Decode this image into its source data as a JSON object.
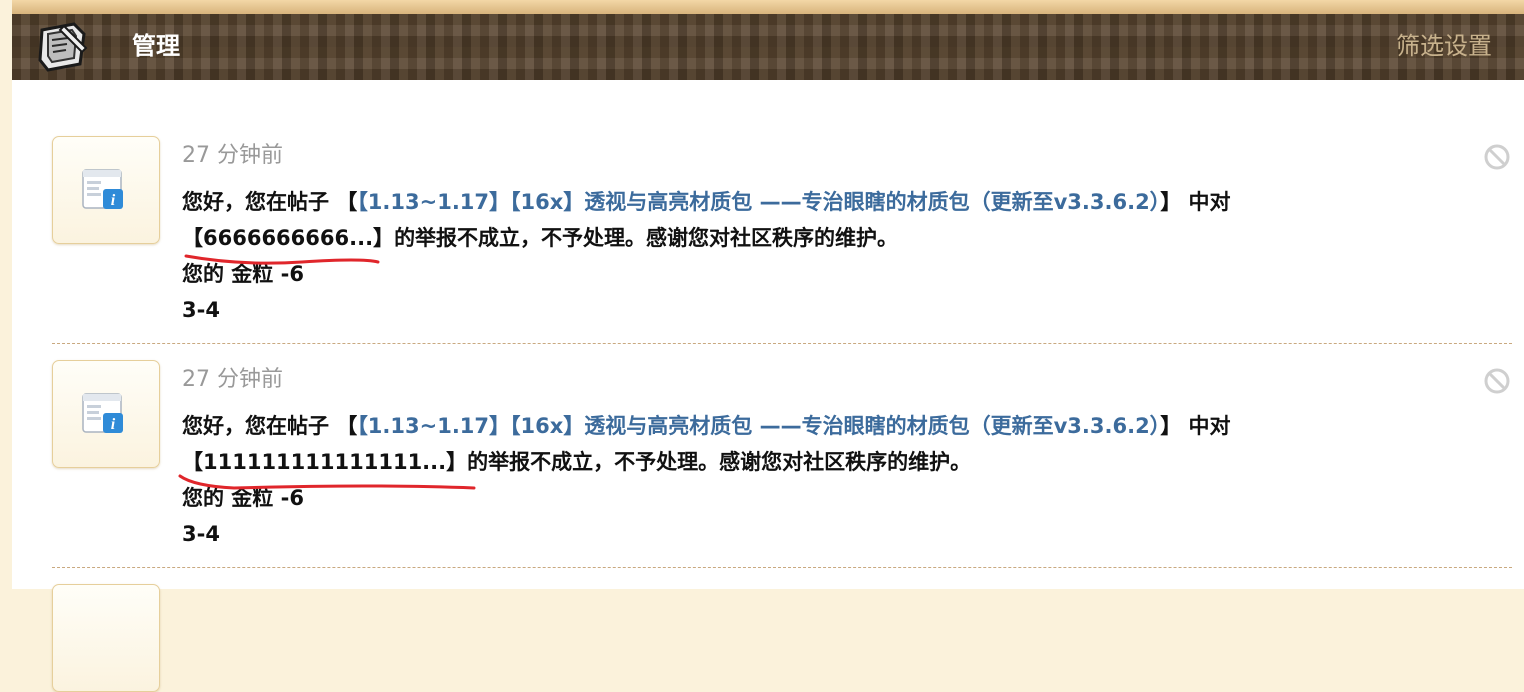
{
  "header": {
    "title": "管理",
    "filter_label": "筛选设置",
    "logo_icon": "book-quill-icon"
  },
  "notices": [
    {
      "time": "27 分钟前",
      "prefix": "您好，您在帖子 【",
      "post_link": "【1.13~1.17】【16x】透视与高亮材质包 ——专治眼瞎的材质包（更新至v3.3.6.2）",
      "after_link": "】 中对",
      "line2_quote": "【6666666666...】",
      "line2_rest": "的举报不成立，不予处理。感谢您对社区秩序的维护。",
      "credits": "您的 金粒 -6",
      "extra": "3-4",
      "ban_icon": "ban-icon"
    },
    {
      "time": "27 分钟前",
      "prefix": "您好，您在帖子 【",
      "post_link": "【1.13~1.17】【16x】透视与高亮材质包 ——专治眼瞎的材质包（更新至v3.3.6.2）",
      "after_link": "】 中对",
      "line2_quote": "【111111111111111...】",
      "line2_rest": "的举报不成立，不予处理。感谢您对社区秩序的维护。",
      "credits": "您的 金粒 -6",
      "extra": "3-4",
      "ban_icon": "ban-icon"
    }
  ],
  "colors": {
    "header_bg": "#5a4630",
    "link": "#3c6b9c",
    "annotation": "#e0262b",
    "page_bg": "#fbf2db"
  }
}
